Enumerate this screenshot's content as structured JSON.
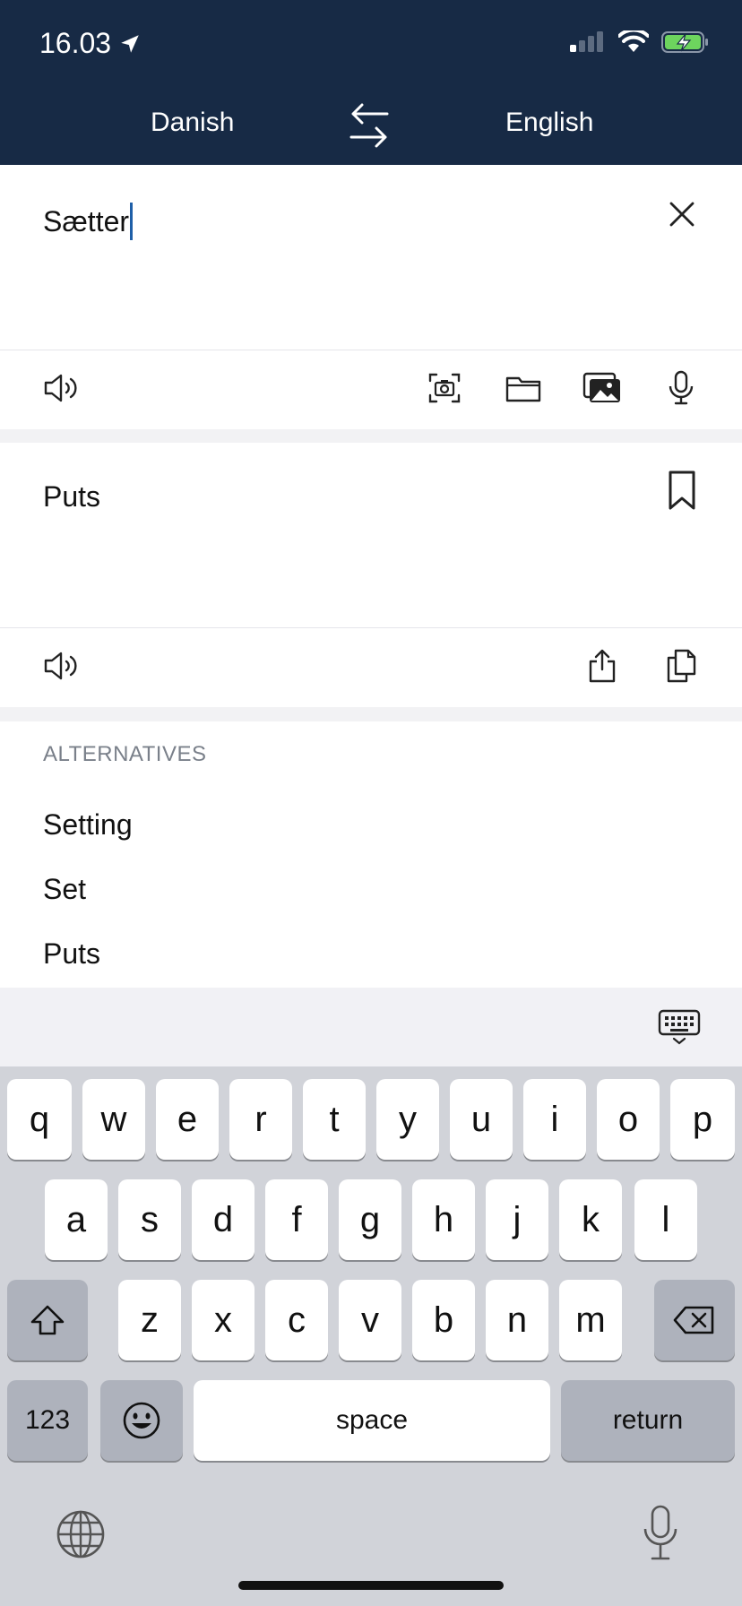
{
  "status_bar": {
    "time": "16.03",
    "icons": [
      "location-arrow-icon",
      "cellular-signal-icon",
      "wifi-icon",
      "battery-charging-icon"
    ]
  },
  "header": {
    "source_language": "Danish",
    "target_language": "English",
    "swap_icon": "swap-arrows-icon"
  },
  "input": {
    "text": "Sætter",
    "clear_icon": "close-icon"
  },
  "input_toolbar": {
    "icons": [
      "speaker-icon",
      "camera-scan-icon",
      "folder-icon",
      "photos-icon",
      "microphone-icon"
    ]
  },
  "output": {
    "text": "Puts",
    "bookmark_icon": "bookmark-icon"
  },
  "output_toolbar": {
    "icons": [
      "speaker-icon",
      "share-icon",
      "copy-icon"
    ]
  },
  "alternatives": {
    "title": "ALTERNATIVES",
    "items": [
      "Setting",
      "Set",
      "Puts"
    ]
  },
  "keyboard": {
    "row1": [
      "q",
      "w",
      "e",
      "r",
      "t",
      "y",
      "u",
      "i",
      "o",
      "p"
    ],
    "row2": [
      "a",
      "s",
      "d",
      "f",
      "g",
      "h",
      "j",
      "k",
      "l"
    ],
    "row3": [
      "z",
      "x",
      "c",
      "v",
      "b",
      "n",
      "m"
    ],
    "numbers_label": "123",
    "space_label": "space",
    "return_label": "return"
  },
  "colors": {
    "header_bg": "#172a45",
    "caret": "#1f5fa8",
    "keyboard_bg": "#d1d3d9"
  }
}
